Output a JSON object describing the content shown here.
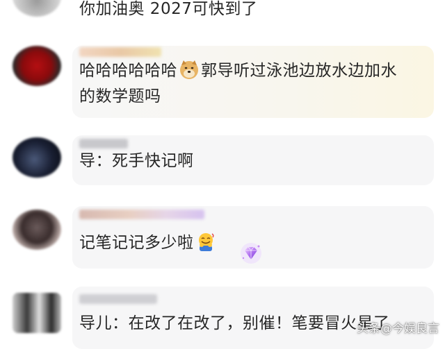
{
  "comments": [
    {
      "text": "你加油奥 2027可快到了"
    },
    {
      "text_before": "哈哈哈哈哈哈",
      "emoji": "doge-emoji",
      "text_after": "郭导听过泳池边放水边加水",
      "text_line2": "的数学题吗"
    },
    {
      "text": "导：死手快记啊"
    },
    {
      "text": "记笔记记多少啦",
      "emoji": "hug-emoji",
      "badge": "gem-badge"
    },
    {
      "text": "导儿：在改了在改了，别催！笔要冒火星了"
    }
  ],
  "watermark": "头条@今娱良言",
  "colors": {
    "card_bg": "#f6f6f7",
    "highlight_bg": "#fbf8e9",
    "text": "#262626"
  }
}
